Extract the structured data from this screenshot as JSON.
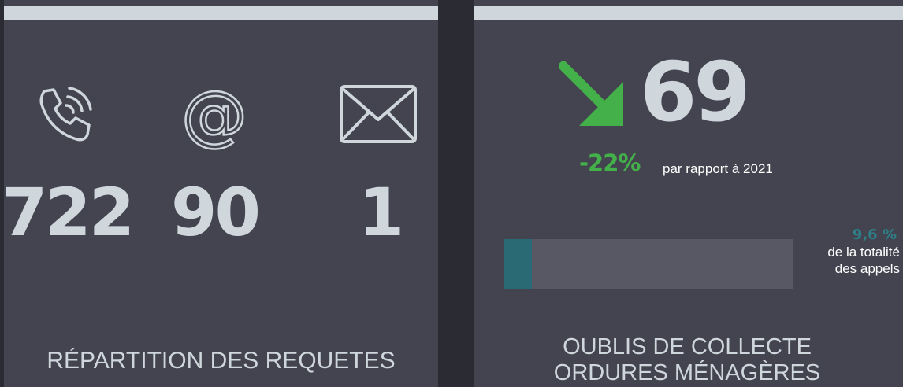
{
  "requests_panel": {
    "phone_count": "722",
    "email_count": "90",
    "mail_count": "1",
    "caption": "RÉPARTITION DES REQUETES",
    "icons": [
      "phone-icon",
      "at-icon",
      "envelope-icon"
    ]
  },
  "missed_collection_panel": {
    "value": "69",
    "trend_icon": "arrow-down-right-icon",
    "change_percent": "-22%",
    "change_text": "par rapport à 2021",
    "share_percent": "9,6 %",
    "share_fraction": 0.096,
    "share_text_line1": "de la totalité",
    "share_text_line2": "des appels",
    "caption_line1": "OUBLIS DE COLLECTE",
    "caption_line2": "ORDURES MÉNAGÈRES"
  },
  "colors": {
    "background": "#2b2c33",
    "panel": "#43444f",
    "light": "#cfd6dc",
    "green": "#43b049",
    "teal": "#2f7d86",
    "track": "#575864"
  }
}
